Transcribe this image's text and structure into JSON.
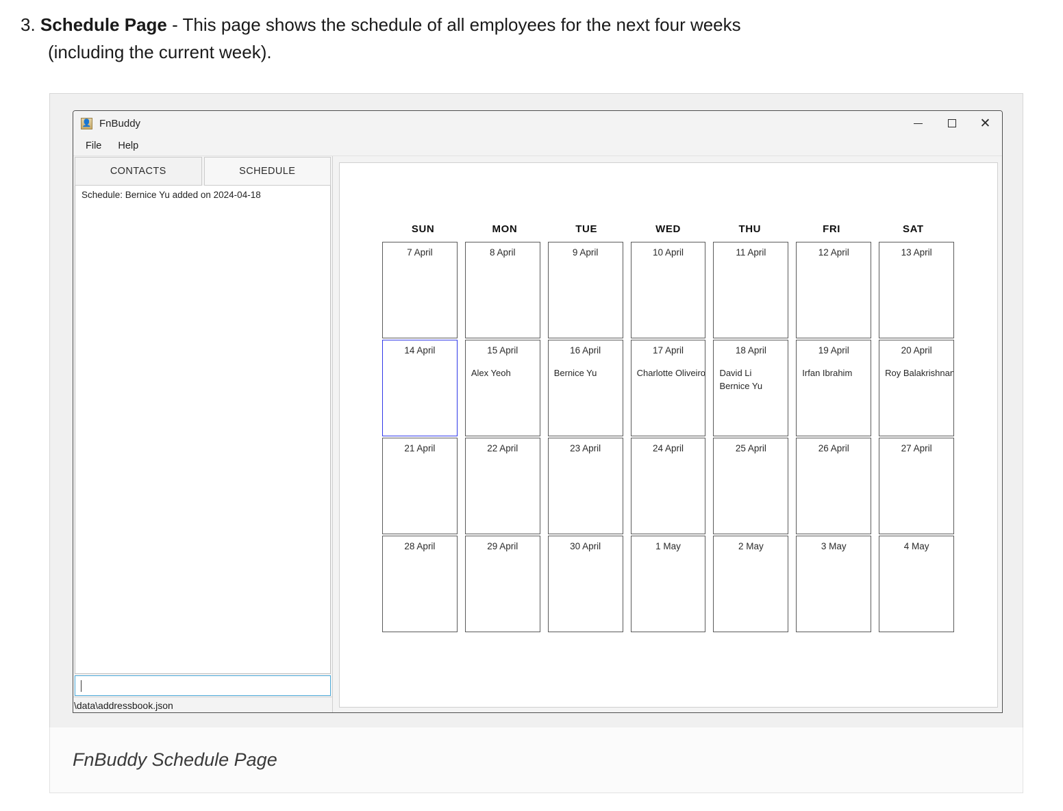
{
  "document": {
    "item_number": "3.",
    "heading": "Schedule Page",
    "description_part1": " - This page shows the schedule of all employees for the next four weeks",
    "description_part2": "(including the current week)."
  },
  "figure_caption": "FnBuddy Schedule Page",
  "window": {
    "title": "FnBuddy",
    "icon": "person-icon",
    "controls": {
      "minimize": "minimize-icon",
      "maximize": "maximize-icon",
      "close": "close-icon"
    },
    "menu": [
      {
        "label": "File"
      },
      {
        "label": "Help"
      }
    ]
  },
  "left_panel": {
    "tabs": [
      {
        "label": "CONTACTS",
        "active": false
      },
      {
        "label": "SCHEDULE",
        "active": true
      }
    ],
    "result_entry": "Schedule: Bernice Yu added on 2024-04-18",
    "command_input": {
      "value": "",
      "placeholder": ""
    },
    "status_bar": "\\data\\addressbook.json"
  },
  "calendar": {
    "day_headers": [
      "SUN",
      "MON",
      "TUE",
      "WED",
      "THU",
      "FRI",
      "SAT"
    ],
    "selected_date": "14 April",
    "weeks": [
      [
        {
          "date": "7 April",
          "names": []
        },
        {
          "date": "8 April",
          "names": []
        },
        {
          "date": "9 April",
          "names": []
        },
        {
          "date": "10 April",
          "names": []
        },
        {
          "date": "11 April",
          "names": []
        },
        {
          "date": "12 April",
          "names": []
        },
        {
          "date": "13 April",
          "names": []
        }
      ],
      [
        {
          "date": "14 April",
          "names": [],
          "selected": true
        },
        {
          "date": "15 April",
          "names": [
            "Alex Yeoh"
          ]
        },
        {
          "date": "16 April",
          "names": [
            "Bernice Yu"
          ]
        },
        {
          "date": "17 April",
          "names": [
            "Charlotte Oliveiro"
          ]
        },
        {
          "date": "18 April",
          "names": [
            "David Li",
            "Bernice Yu"
          ]
        },
        {
          "date": "19 April",
          "names": [
            "Irfan Ibrahim"
          ]
        },
        {
          "date": "20 April",
          "names": [
            "Roy Balakrishnan"
          ]
        }
      ],
      [
        {
          "date": "21 April",
          "names": []
        },
        {
          "date": "22 April",
          "names": []
        },
        {
          "date": "23 April",
          "names": []
        },
        {
          "date": "24 April",
          "names": []
        },
        {
          "date": "25 April",
          "names": []
        },
        {
          "date": "26 April",
          "names": []
        },
        {
          "date": "27 April",
          "names": []
        }
      ],
      [
        {
          "date": "28 April",
          "names": []
        },
        {
          "date": "29 April",
          "names": []
        },
        {
          "date": "30 April",
          "names": []
        },
        {
          "date": "1 May",
          "names": []
        },
        {
          "date": "2 May",
          "names": []
        },
        {
          "date": "3 May",
          "names": []
        },
        {
          "date": "4 May",
          "names": []
        }
      ]
    ]
  },
  "colors": {
    "selection_border": "#2f37e8",
    "input_focus_border": "#4aa8d8",
    "window_chrome": "#f3f3f3",
    "cell_border": "#5a5a5a"
  }
}
